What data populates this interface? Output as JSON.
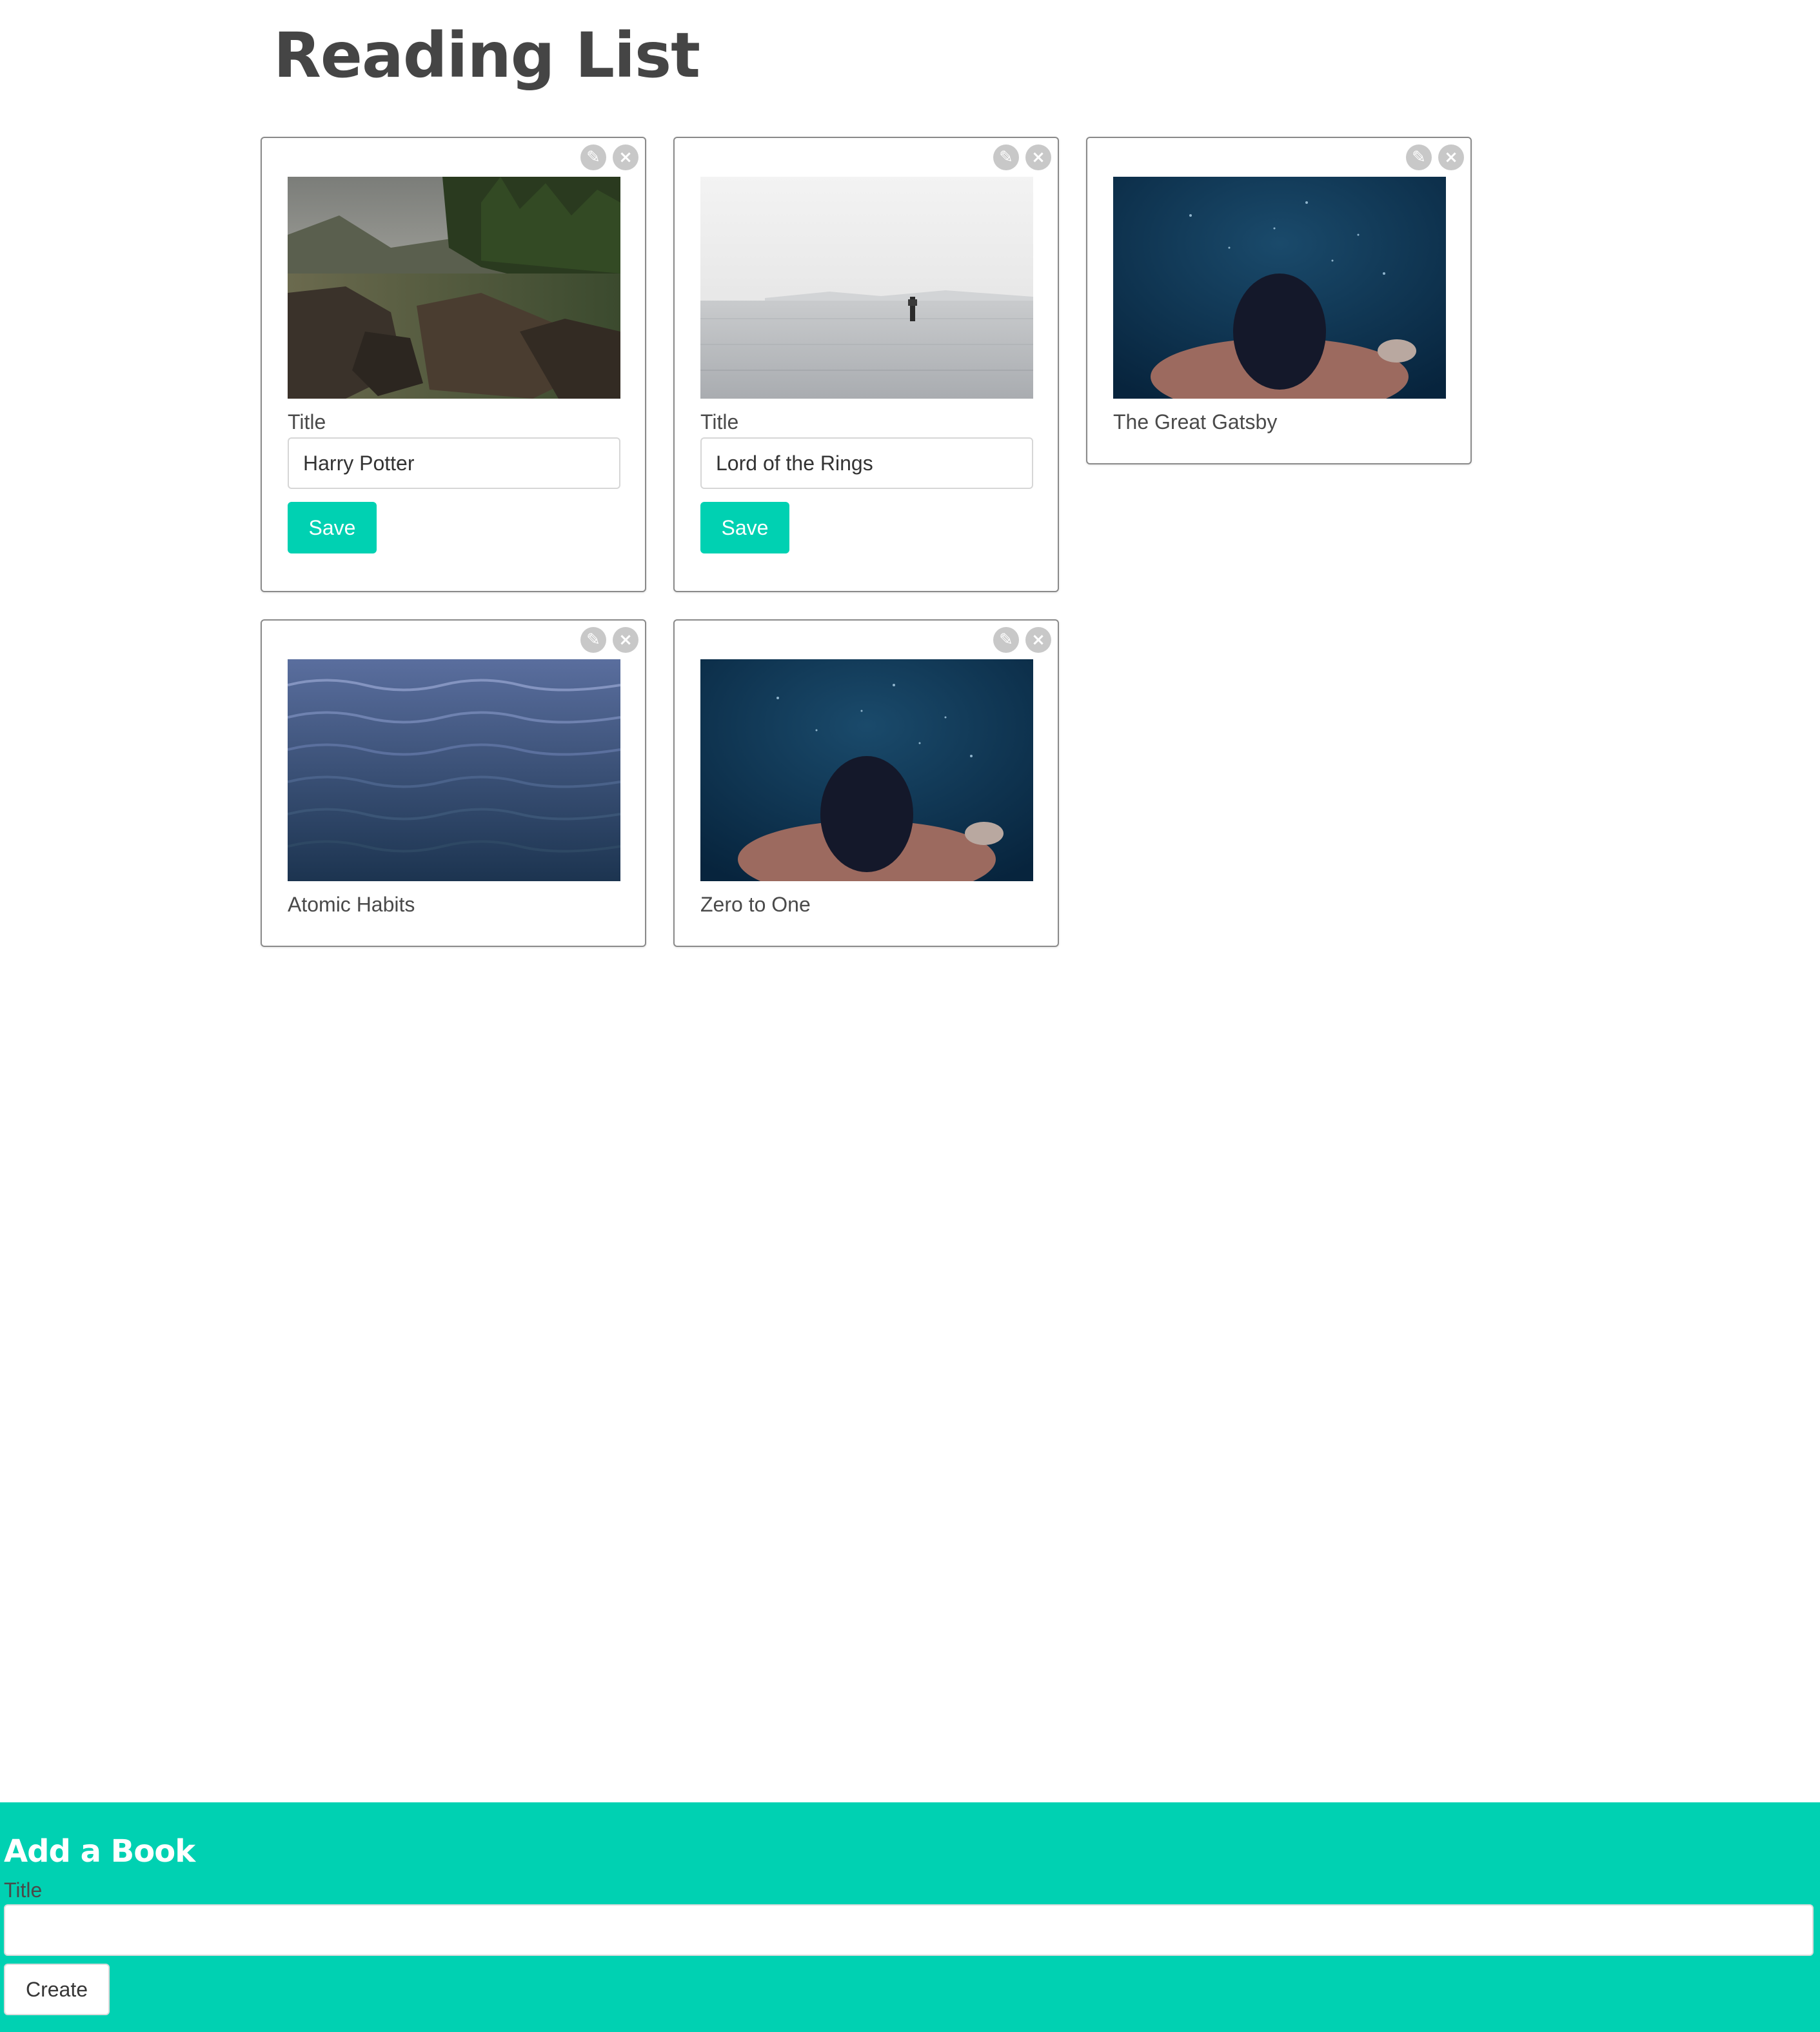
{
  "page": {
    "title": "Reading List"
  },
  "icons": {
    "edit": "pencil-icon",
    "delete": "close-icon"
  },
  "colors": {
    "accent": "#00d1b2",
    "icon_bg": "#c8c8c8",
    "heading": "#454545"
  },
  "books": [
    {
      "mode": "edit",
      "image": "river-rocks-forest",
      "label": "Title",
      "value": "Harry Potter",
      "save_label": "Save"
    },
    {
      "mode": "edit",
      "image": "calm-sea-marker",
      "label": "Title",
      "value": "Lord of the Rings",
      "save_label": "Save"
    },
    {
      "mode": "view",
      "image": "underwater-swimmer",
      "title": "The Great Gatsby"
    },
    {
      "mode": "view",
      "image": "ocean-waves",
      "title": "Atomic Habits"
    },
    {
      "mode": "view",
      "image": "underwater-swimmer",
      "title": "Zero to One"
    }
  ],
  "add_form": {
    "title": "Add a Book",
    "label": "Title",
    "value": "",
    "create_label": "Create"
  }
}
